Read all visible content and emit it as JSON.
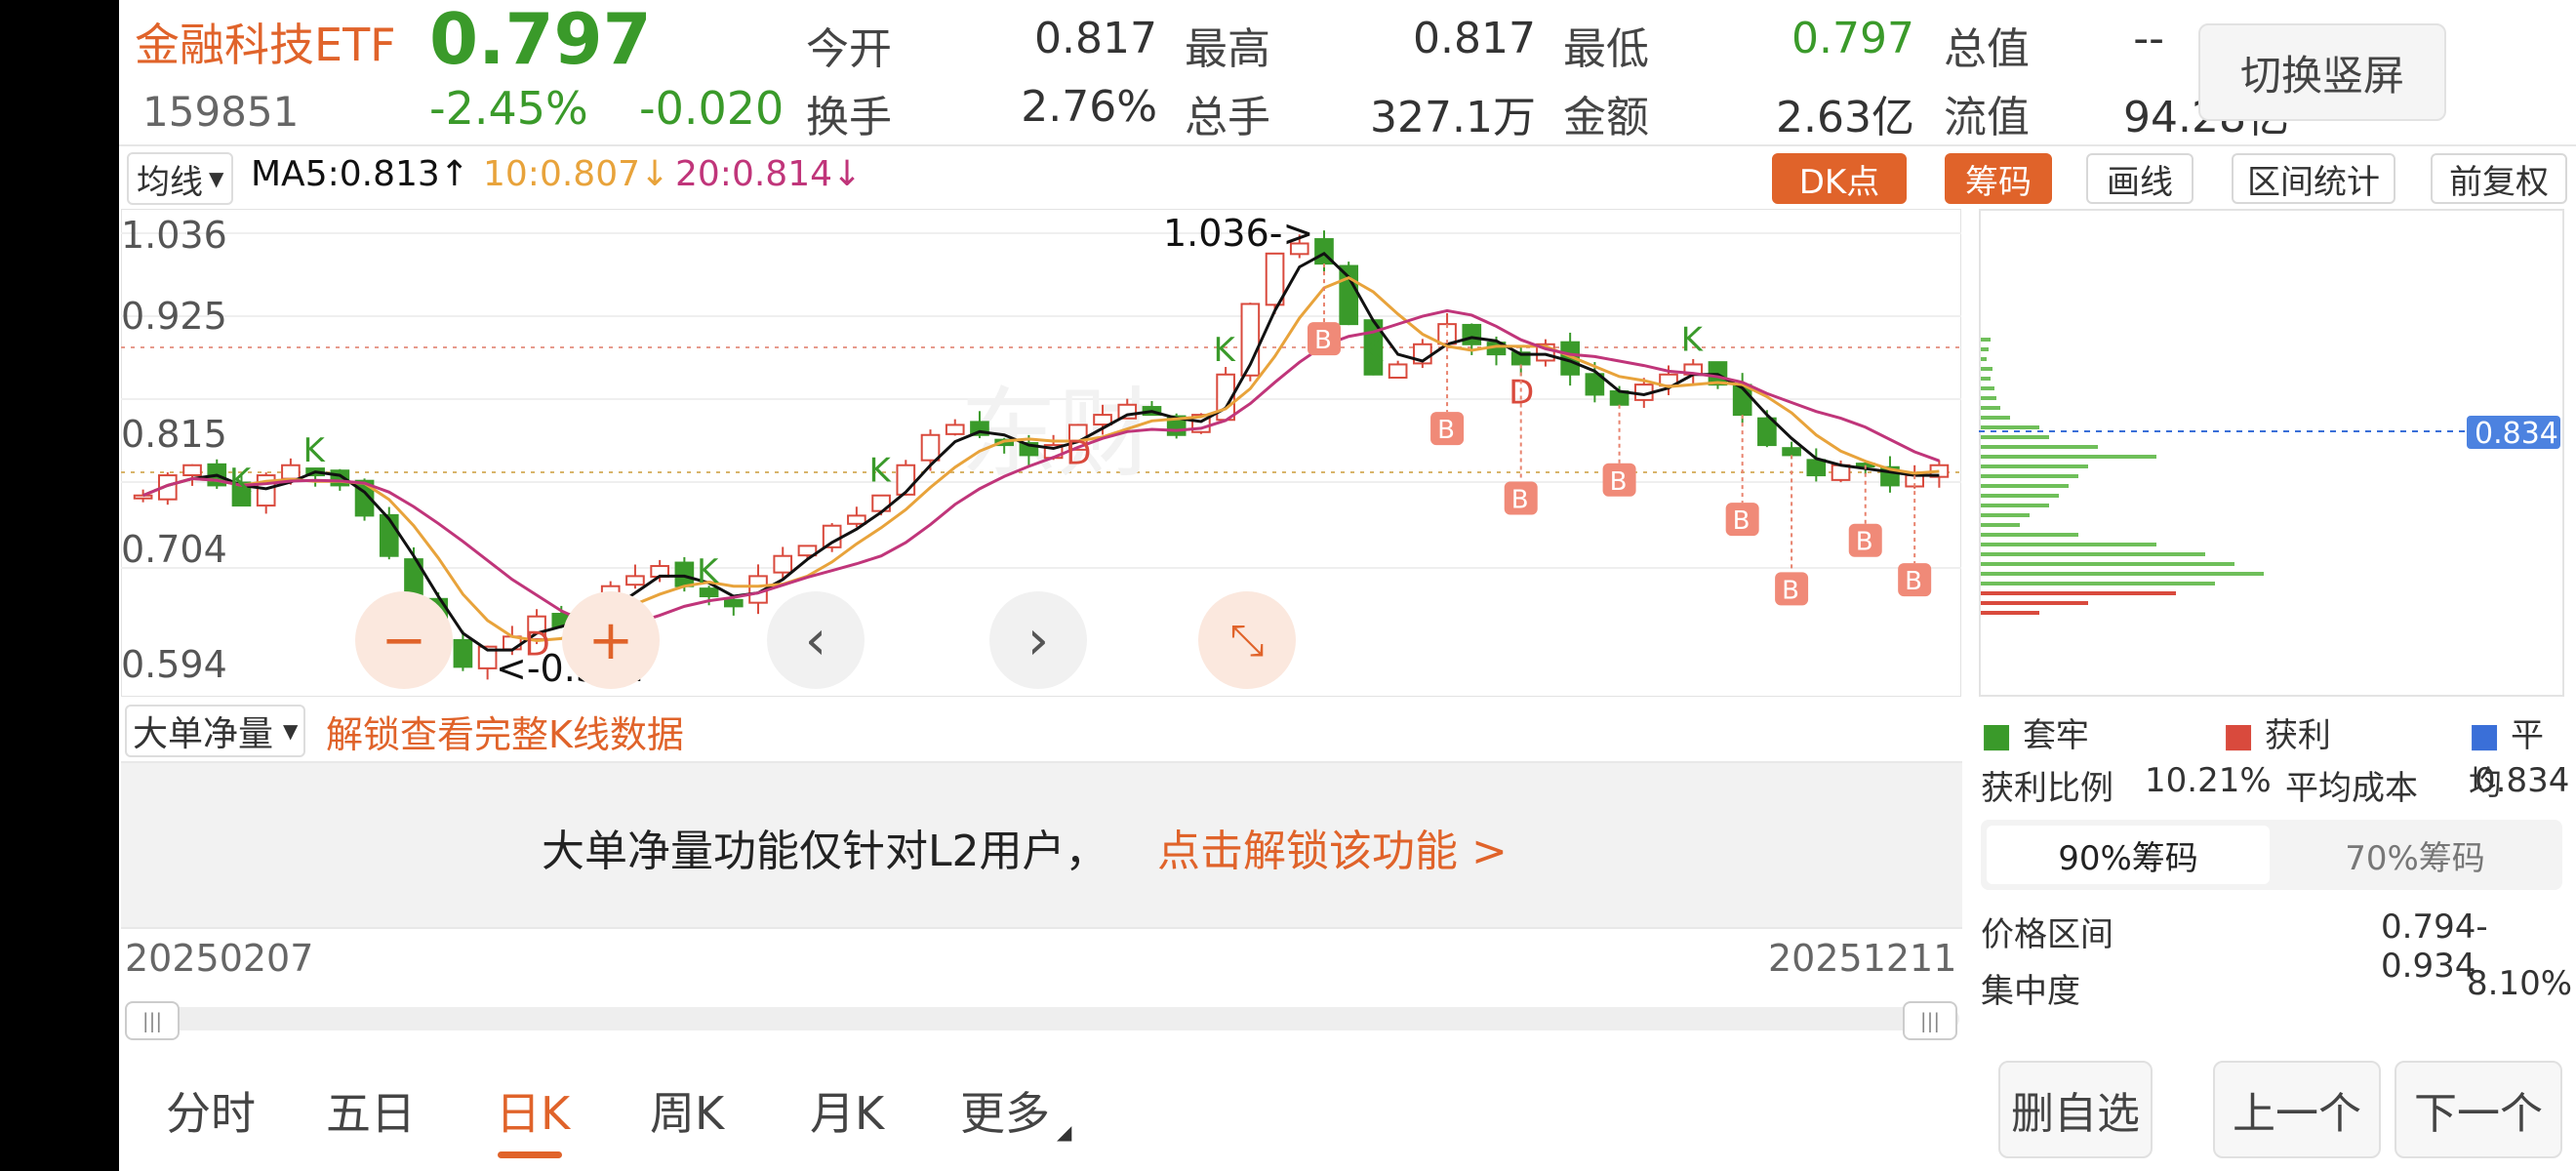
{
  "header": {
    "name": "金融科技ETF",
    "price": "0.797",
    "code": "159851",
    "change_pct": "-2.45%",
    "change_abs": "-0.020",
    "stats": [
      {
        "label": "今开",
        "value": "0.817"
      },
      {
        "label": "最高",
        "value": "0.817"
      },
      {
        "label": "最低",
        "value": "0.797"
      },
      {
        "label": "总值",
        "value": "--"
      },
      {
        "label": "换手",
        "value": "2.76%"
      },
      {
        "label": "总手",
        "value": "327.1万"
      },
      {
        "label": "金额",
        "value": "2.63亿"
      },
      {
        "label": "流值",
        "value": "94.28亿"
      }
    ],
    "switch_label": "切换竖屏"
  },
  "ma_bar": {
    "selector": "均线",
    "ma5": "MA5:0.813↑",
    "ma10": "10:0.807↓",
    "ma20": "20:0.814↓"
  },
  "toolbar": {
    "dk": "DK点",
    "chip": "筹码",
    "draw": "画线",
    "range": "区间统计",
    "adjust": "前复权"
  },
  "chart_data": {
    "type": "candlestick",
    "y_ticks": [
      "1.036",
      "0.925",
      "0.815",
      "0.704",
      "0.594"
    ],
    "high_label": "1.036->",
    "low_label": "<-0.594",
    "current_price_tag": "0.834",
    "start_date": "20250207",
    "end_date": "20251211",
    "series": [
      {
        "name": "MA5",
        "color": "#111111"
      },
      {
        "name": "MA10",
        "color": "#e8a33b"
      },
      {
        "name": "MA20",
        "color": "#c0357a"
      }
    ],
    "close_series": [
      0.78,
      0.8,
      0.81,
      0.79,
      0.77,
      0.8,
      0.81,
      0.8,
      0.79,
      0.76,
      0.72,
      0.68,
      0.64,
      0.61,
      0.63,
      0.64,
      0.66,
      0.65,
      0.66,
      0.69,
      0.7,
      0.71,
      0.69,
      0.68,
      0.67,
      0.7,
      0.72,
      0.73,
      0.75,
      0.76,
      0.78,
      0.81,
      0.84,
      0.85,
      0.84,
      0.83,
      0.82,
      0.83,
      0.85,
      0.86,
      0.87,
      0.86,
      0.84,
      0.86,
      0.9,
      0.97,
      1.02,
      1.03,
      1.01,
      0.95,
      0.9,
      0.91,
      0.93,
      0.95,
      0.93,
      0.92,
      0.91,
      0.93,
      0.9,
      0.88,
      0.87,
      0.89,
      0.9,
      0.91,
      0.89,
      0.86,
      0.83,
      0.82,
      0.8,
      0.81,
      0.81,
      0.79,
      0.8,
      0.81
    ]
  },
  "lower_panel": {
    "selector": "大单净量",
    "unlock": "解锁查看完整K线数据",
    "notice": "大单净量功能仅针对L2用户，",
    "notice_link": "点击解锁该功能 >"
  },
  "chips": {
    "legend": [
      "套牢",
      "获利",
      "平均"
    ],
    "profit_ratio_label": "获利比例",
    "profit_ratio": "10.21%",
    "avg_cost_label": "平均成本",
    "avg_cost": "0.834",
    "tab90": "90%筹码",
    "tab70": "70%筹码",
    "range_label": "价格区间",
    "range_value": "0.794-0.934",
    "conc_label": "集中度",
    "conc_value": "8.10%"
  },
  "tabs": [
    "分时",
    "五日",
    "日K",
    "周K",
    "月K",
    "更多"
  ],
  "bottom_buttons": [
    "删自选",
    "上一个",
    "下一个"
  ]
}
